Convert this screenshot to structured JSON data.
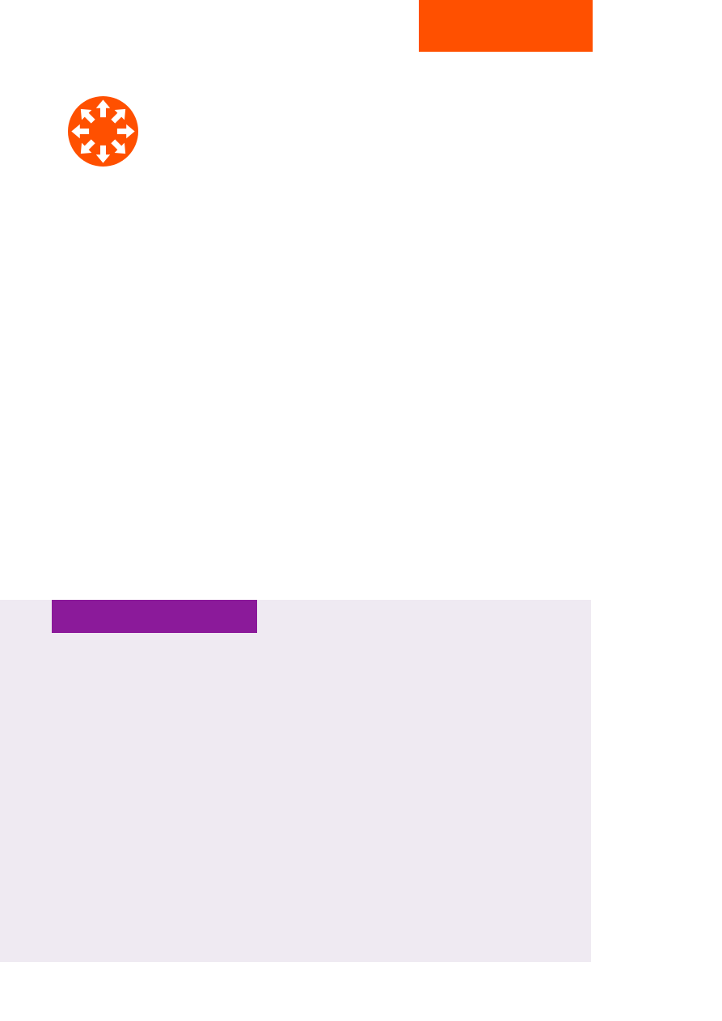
{
  "colors": {
    "page_background": "#ffffff",
    "accent_orange": "#ff5000",
    "accent_purple": "#8b1a9a",
    "panel_background": "#efeaf2",
    "icon_glyph": "#ffffff"
  },
  "icons": {
    "emblem": "expand-arrows-circle-icon"
  }
}
